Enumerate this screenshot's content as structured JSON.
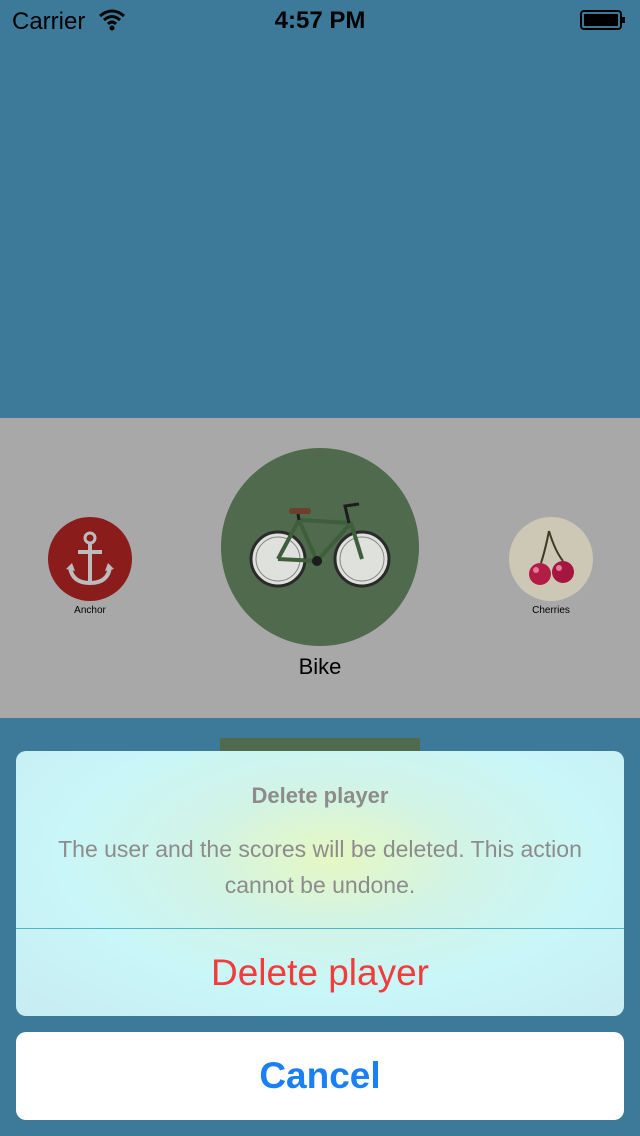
{
  "status_bar": {
    "carrier": "Carrier",
    "time": "4:57 PM",
    "wifi_icon": "wifi-icon",
    "battery_icon": "battery-icon"
  },
  "picker": {
    "items": [
      {
        "label": "Anchor",
        "icon": "anchor-icon",
        "color": "#8a1c1c"
      },
      {
        "label": "Bike",
        "icon": "bike-icon",
        "color": "#4f6a4c"
      },
      {
        "label": "Cherries",
        "icon": "cherries-icon",
        "color": "#cdc7b6"
      }
    ]
  },
  "alert": {
    "title": "Delete player",
    "message": "The user and the scores will be deleted. This action cannot be undone.",
    "destructive_label": "Delete player",
    "cancel_label": "Cancel"
  },
  "colors": {
    "background": "#3d7a9a",
    "destructive": "#f23b3b",
    "accent": "#1b7ff5"
  }
}
